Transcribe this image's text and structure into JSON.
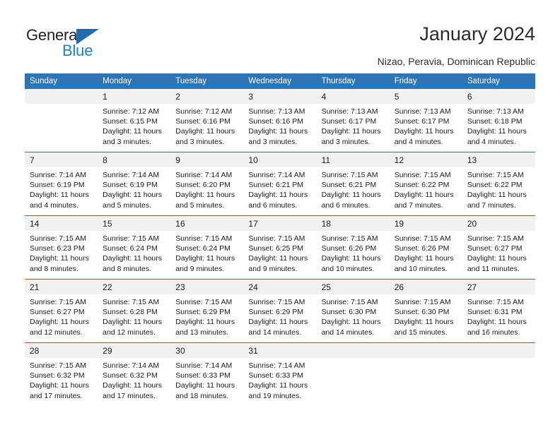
{
  "brand": {
    "name_part1": "General",
    "name_part2": "Blue",
    "accent_color": "#1f7fd0",
    "triangle_color": "#1f6cb0"
  },
  "header": {
    "title": "January 2024",
    "location": "Nizao, Peravia, Dominican Republic"
  },
  "calendar": {
    "header_color": "#2e75b6",
    "daynum_background": "#f1f1f1",
    "weekdays": [
      "Sunday",
      "Monday",
      "Tuesday",
      "Wednesday",
      "Thursday",
      "Friday",
      "Saturday"
    ],
    "weeks": [
      [
        {
          "day": "",
          "sunrise": "",
          "sunset": "",
          "daylight_line1": "",
          "daylight_line2": ""
        },
        {
          "day": "1",
          "sunrise": "Sunrise: 7:12 AM",
          "sunset": "Sunset: 6:15 PM",
          "daylight_line1": "Daylight: 11 hours",
          "daylight_line2": "and 3 minutes."
        },
        {
          "day": "2",
          "sunrise": "Sunrise: 7:12 AM",
          "sunset": "Sunset: 6:16 PM",
          "daylight_line1": "Daylight: 11 hours",
          "daylight_line2": "and 3 minutes."
        },
        {
          "day": "3",
          "sunrise": "Sunrise: 7:13 AM",
          "sunset": "Sunset: 6:16 PM",
          "daylight_line1": "Daylight: 11 hours",
          "daylight_line2": "and 3 minutes."
        },
        {
          "day": "4",
          "sunrise": "Sunrise: 7:13 AM",
          "sunset": "Sunset: 6:17 PM",
          "daylight_line1": "Daylight: 11 hours",
          "daylight_line2": "and 3 minutes."
        },
        {
          "day": "5",
          "sunrise": "Sunrise: 7:13 AM",
          "sunset": "Sunset: 6:17 PM",
          "daylight_line1": "Daylight: 11 hours",
          "daylight_line2": "and 4 minutes."
        },
        {
          "day": "6",
          "sunrise": "Sunrise: 7:13 AM",
          "sunset": "Sunset: 6:18 PM",
          "daylight_line1": "Daylight: 11 hours",
          "daylight_line2": "and 4 minutes."
        }
      ],
      [
        {
          "day": "7",
          "sunrise": "Sunrise: 7:14 AM",
          "sunset": "Sunset: 6:19 PM",
          "daylight_line1": "Daylight: 11 hours",
          "daylight_line2": "and 4 minutes."
        },
        {
          "day": "8",
          "sunrise": "Sunrise: 7:14 AM",
          "sunset": "Sunset: 6:19 PM",
          "daylight_line1": "Daylight: 11 hours",
          "daylight_line2": "and 5 minutes."
        },
        {
          "day": "9",
          "sunrise": "Sunrise: 7:14 AM",
          "sunset": "Sunset: 6:20 PM",
          "daylight_line1": "Daylight: 11 hours",
          "daylight_line2": "and 5 minutes."
        },
        {
          "day": "10",
          "sunrise": "Sunrise: 7:14 AM",
          "sunset": "Sunset: 6:21 PM",
          "daylight_line1": "Daylight: 11 hours",
          "daylight_line2": "and 6 minutes."
        },
        {
          "day": "11",
          "sunrise": "Sunrise: 7:15 AM",
          "sunset": "Sunset: 6:21 PM",
          "daylight_line1": "Daylight: 11 hours",
          "daylight_line2": "and 6 minutes."
        },
        {
          "day": "12",
          "sunrise": "Sunrise: 7:15 AM",
          "sunset": "Sunset: 6:22 PM",
          "daylight_line1": "Daylight: 11 hours",
          "daylight_line2": "and 7 minutes."
        },
        {
          "day": "13",
          "sunrise": "Sunrise: 7:15 AM",
          "sunset": "Sunset: 6:22 PM",
          "daylight_line1": "Daylight: 11 hours",
          "daylight_line2": "and 7 minutes."
        }
      ],
      [
        {
          "day": "14",
          "sunrise": "Sunrise: 7:15 AM",
          "sunset": "Sunset: 6:23 PM",
          "daylight_line1": "Daylight: 11 hours",
          "daylight_line2": "and 8 minutes."
        },
        {
          "day": "15",
          "sunrise": "Sunrise: 7:15 AM",
          "sunset": "Sunset: 6:24 PM",
          "daylight_line1": "Daylight: 11 hours",
          "daylight_line2": "and 8 minutes."
        },
        {
          "day": "16",
          "sunrise": "Sunrise: 7:15 AM",
          "sunset": "Sunset: 6:24 PM",
          "daylight_line1": "Daylight: 11 hours",
          "daylight_line2": "and 9 minutes."
        },
        {
          "day": "17",
          "sunrise": "Sunrise: 7:15 AM",
          "sunset": "Sunset: 6:25 PM",
          "daylight_line1": "Daylight: 11 hours",
          "daylight_line2": "and 9 minutes."
        },
        {
          "day": "18",
          "sunrise": "Sunrise: 7:15 AM",
          "sunset": "Sunset: 6:26 PM",
          "daylight_line1": "Daylight: 11 hours",
          "daylight_line2": "and 10 minutes."
        },
        {
          "day": "19",
          "sunrise": "Sunrise: 7:15 AM",
          "sunset": "Sunset: 6:26 PM",
          "daylight_line1": "Daylight: 11 hours",
          "daylight_line2": "and 10 minutes."
        },
        {
          "day": "20",
          "sunrise": "Sunrise: 7:15 AM",
          "sunset": "Sunset: 6:27 PM",
          "daylight_line1": "Daylight: 11 hours",
          "daylight_line2": "and 11 minutes."
        }
      ],
      [
        {
          "day": "21",
          "sunrise": "Sunrise: 7:15 AM",
          "sunset": "Sunset: 6:27 PM",
          "daylight_line1": "Daylight: 11 hours",
          "daylight_line2": "and 12 minutes."
        },
        {
          "day": "22",
          "sunrise": "Sunrise: 7:15 AM",
          "sunset": "Sunset: 6:28 PM",
          "daylight_line1": "Daylight: 11 hours",
          "daylight_line2": "and 12 minutes."
        },
        {
          "day": "23",
          "sunrise": "Sunrise: 7:15 AM",
          "sunset": "Sunset: 6:29 PM",
          "daylight_line1": "Daylight: 11 hours",
          "daylight_line2": "and 13 minutes."
        },
        {
          "day": "24",
          "sunrise": "Sunrise: 7:15 AM",
          "sunset": "Sunset: 6:29 PM",
          "daylight_line1": "Daylight: 11 hours",
          "daylight_line2": "and 14 minutes."
        },
        {
          "day": "25",
          "sunrise": "Sunrise: 7:15 AM",
          "sunset": "Sunset: 6:30 PM",
          "daylight_line1": "Daylight: 11 hours",
          "daylight_line2": "and 14 minutes."
        },
        {
          "day": "26",
          "sunrise": "Sunrise: 7:15 AM",
          "sunset": "Sunset: 6:30 PM",
          "daylight_line1": "Daylight: 11 hours",
          "daylight_line2": "and 15 minutes."
        },
        {
          "day": "27",
          "sunrise": "Sunrise: 7:15 AM",
          "sunset": "Sunset: 6:31 PM",
          "daylight_line1": "Daylight: 11 hours",
          "daylight_line2": "and 16 minutes."
        }
      ],
      [
        {
          "day": "28",
          "sunrise": "Sunrise: 7:15 AM",
          "sunset": "Sunset: 6:32 PM",
          "daylight_line1": "Daylight: 11 hours",
          "daylight_line2": "and 17 minutes."
        },
        {
          "day": "29",
          "sunrise": "Sunrise: 7:14 AM",
          "sunset": "Sunset: 6:32 PM",
          "daylight_line1": "Daylight: 11 hours",
          "daylight_line2": "and 17 minutes."
        },
        {
          "day": "30",
          "sunrise": "Sunrise: 7:14 AM",
          "sunset": "Sunset: 6:33 PM",
          "daylight_line1": "Daylight: 11 hours",
          "daylight_line2": "and 18 minutes."
        },
        {
          "day": "31",
          "sunrise": "Sunrise: 7:14 AM",
          "sunset": "Sunset: 6:33 PM",
          "daylight_line1": "Daylight: 11 hours",
          "daylight_line2": "and 19 minutes."
        },
        {
          "day": "",
          "sunrise": "",
          "sunset": "",
          "daylight_line1": "",
          "daylight_line2": ""
        },
        {
          "day": "",
          "sunrise": "",
          "sunset": "",
          "daylight_line1": "",
          "daylight_line2": ""
        },
        {
          "day": "",
          "sunrise": "",
          "sunset": "",
          "daylight_line1": "",
          "daylight_line2": ""
        }
      ]
    ]
  }
}
